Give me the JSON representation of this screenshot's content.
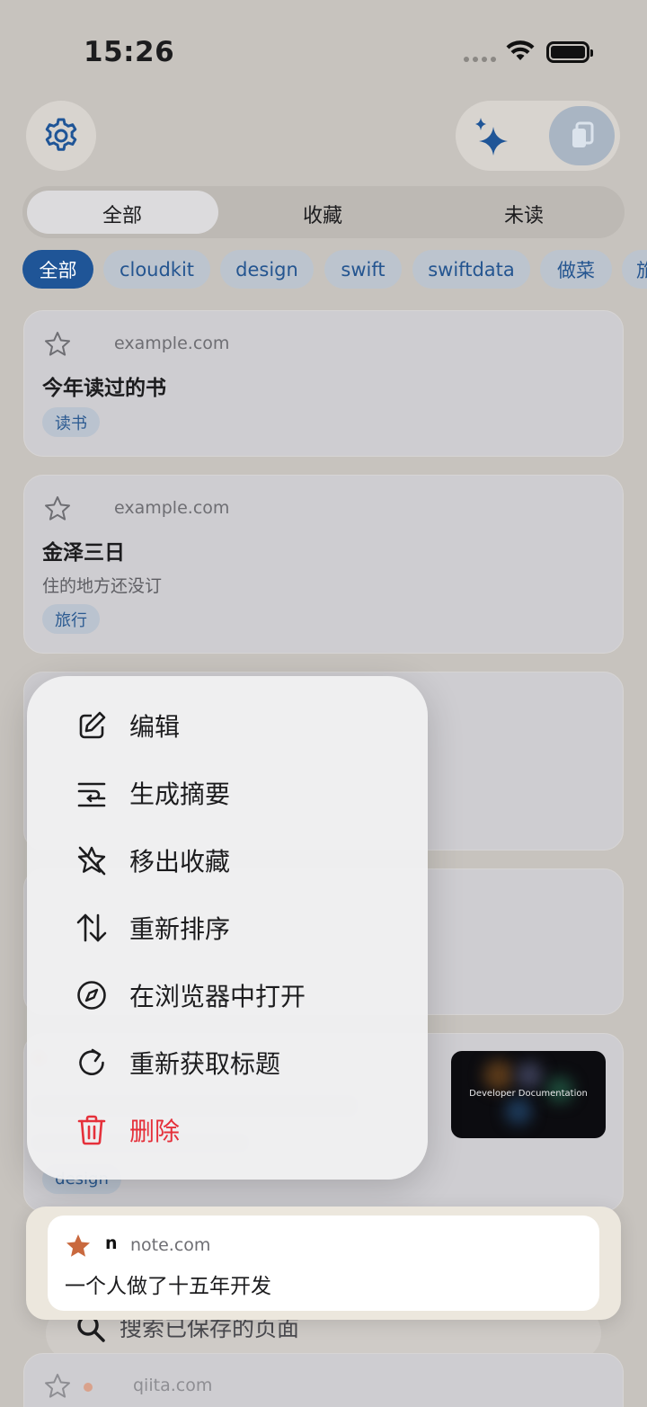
{
  "status_bar": {
    "time": "15:26"
  },
  "segmented": {
    "tabs": [
      "全部",
      "收藏",
      "未读"
    ],
    "active_index": 0
  },
  "chips": [
    "全部",
    "cloudkit",
    "design",
    "swift",
    "swiftdata",
    "做菜",
    "旅"
  ],
  "cards": [
    {
      "domain": "example.com",
      "title": "今年读过的书",
      "subtitle": "",
      "tag": "读书"
    },
    {
      "domain": "example.com",
      "title": "金泽三日",
      "subtitle": "住的地方还没订",
      "tag": "旅行"
    }
  ],
  "background_card": {
    "tag": "design",
    "thumbnail_text": "Developer Documentation"
  },
  "context_menu": {
    "items": [
      {
        "label": "编辑",
        "icon": "edit-square-icon"
      },
      {
        "label": "生成摘要",
        "icon": "summary-lines-icon"
      },
      {
        "label": "移出收藏",
        "icon": "star-slash-icon"
      },
      {
        "label": "重新排序",
        "icon": "reorder-arrows-icon"
      },
      {
        "label": "在浏览器中打开",
        "icon": "compass-icon"
      },
      {
        "label": "重新获取标题",
        "icon": "refresh-icon"
      },
      {
        "label": "删除",
        "icon": "trash-icon",
        "destructive": true
      }
    ]
  },
  "preview_card": {
    "favicon": "n",
    "domain": "note.com",
    "title": "一个人做了十五年开发",
    "starred": true
  },
  "search": {
    "placeholder": "搜索已保存的页面"
  },
  "last_card": {
    "domain": "qiita.com"
  },
  "colors": {
    "accent": "#1f5597",
    "destructive": "#e5303a",
    "star_filled": "#c9693e"
  }
}
